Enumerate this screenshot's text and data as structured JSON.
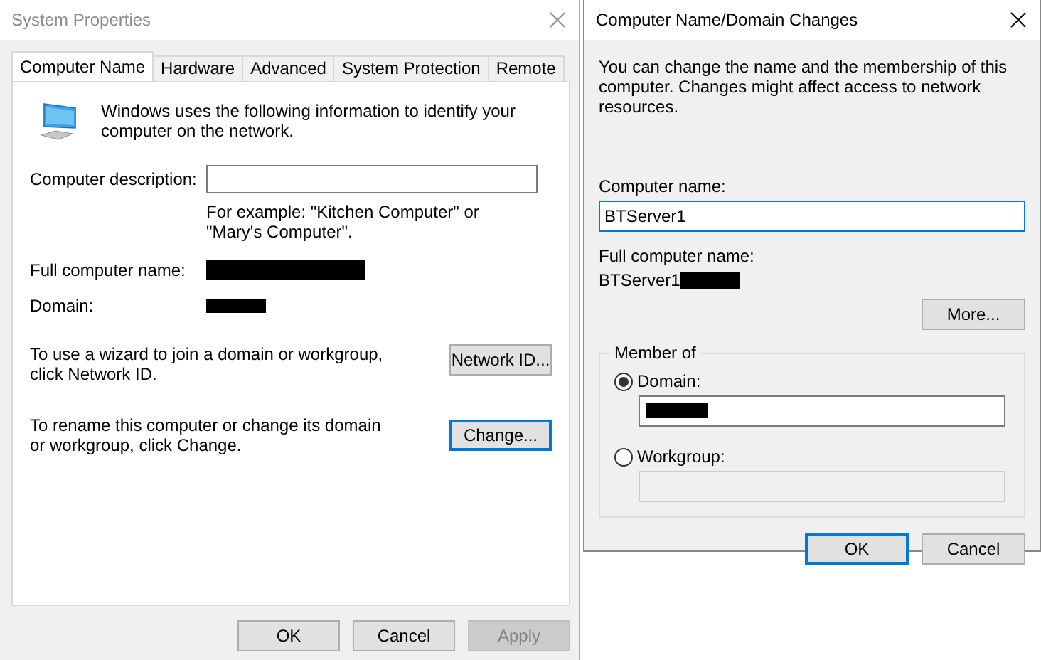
{
  "system_properties": {
    "title": "System Properties",
    "tabs": [
      {
        "label": "Computer Name",
        "selected": true
      },
      {
        "label": "Hardware",
        "selected": false
      },
      {
        "label": "Advanced",
        "selected": false
      },
      {
        "label": "System Protection",
        "selected": false
      },
      {
        "label": "Remote",
        "selected": false
      }
    ],
    "intro": "Windows uses the following information to identify your computer on the network.",
    "description_label": "Computer description:",
    "description_hint": "For example: \"Kitchen Computer\" or \"Mary's Computer\".",
    "full_name_label": "Full computer name:",
    "domain_label": "Domain:",
    "network_id_text": "To use a wizard to join a domain or workgroup, click Network ID.",
    "network_id_button": {
      "label": "Network ID...",
      "focused": false
    },
    "change_text": "To rename this computer or change its domain or workgroup, click Change.",
    "change_button": {
      "label": "Change...",
      "focused": true
    },
    "buttons": [
      {
        "label": "OK",
        "disabled": false
      },
      {
        "label": "Cancel",
        "disabled": false
      },
      {
        "label": "Apply",
        "disabled": true
      }
    ]
  },
  "domain_changes": {
    "title": "Computer Name/Domain Changes",
    "intro": "You can change the name and the membership of this computer. Changes might affect access to network resources.",
    "computer_name_label": "Computer name:",
    "computer_name": {
      "value": "BTServer1",
      "focused": true
    },
    "full_name_label": "Full computer name:",
    "full_name": "BTServer1",
    "more_button": "More...",
    "member_of": {
      "title": "Member of",
      "options": [
        {
          "label": "Domain:",
          "selected": true,
          "disabled": false
        },
        {
          "label": "Workgroup:",
          "selected": false,
          "disabled": true
        }
      ]
    },
    "buttons": [
      {
        "label": "OK",
        "focused": true
      },
      {
        "label": "Cancel",
        "focused": false
      }
    ]
  }
}
